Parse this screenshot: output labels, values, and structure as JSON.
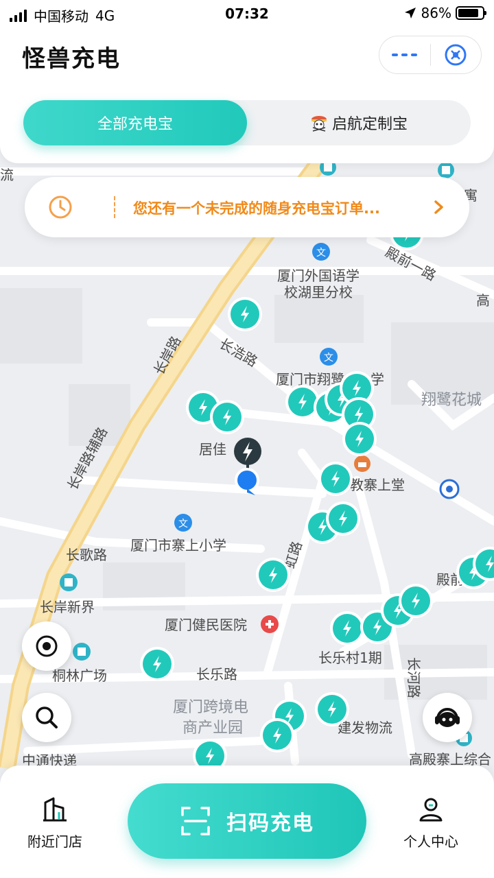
{
  "status_bar": {
    "carrier": "中国移动",
    "network": "4G",
    "time": "07:32",
    "battery": "86%",
    "battery_level": 0.86
  },
  "header": {
    "title": "怪兽充电",
    "tabs": [
      {
        "label": "全部充电宝",
        "active": true
      },
      {
        "label": "启航定制宝",
        "active": false
      }
    ]
  },
  "notice": {
    "message": "您还有一个未完成的随身充电宝订单..."
  },
  "map": {
    "labels": {
      "liu": "流",
      "yu": "寓",
      "school1_a": "厦门外国语学",
      "school1_b": "校湖里分校",
      "dianqian_rd": "殿前一路",
      "gao": "高",
      "changan_rd": "长岸路",
      "changhao_rd": "长浩路",
      "xiangyu_school": "厦门市翔鹭",
      "xue": "学",
      "xianglu_garden": "翔鹭花城",
      "changan_aux": "长岸路辅路",
      "jujia": "居佳",
      "church": "教寨上堂",
      "changge_rd": "长歌路",
      "zhaishang_school": "厦门市寨上小学",
      "hong_rd": "虹路",
      "dianqian": "殿前",
      "changan_xinjie": "长岸新界",
      "jianmin_hospital": "厦门健民医院",
      "changle_village": "长乐村1期",
      "tonglin_plaza": "桐林广场",
      "changle_rd": "长乐路",
      "changhe_rd": "长河路",
      "crossborder_a": "厦门跨境电",
      "crossborder_b": "商产业园",
      "jianfa": "建发物流",
      "gaodian": "高殿寨上综合",
      "zhongtong": "中通快递"
    }
  },
  "bottom_nav": {
    "nearby": "附近门店",
    "scan": "扫码充电",
    "profile": "个人中心"
  },
  "colors": {
    "accent": "#21c9bb",
    "notice": "#f08a1a",
    "capsule_dots": "#2f77f5"
  }
}
